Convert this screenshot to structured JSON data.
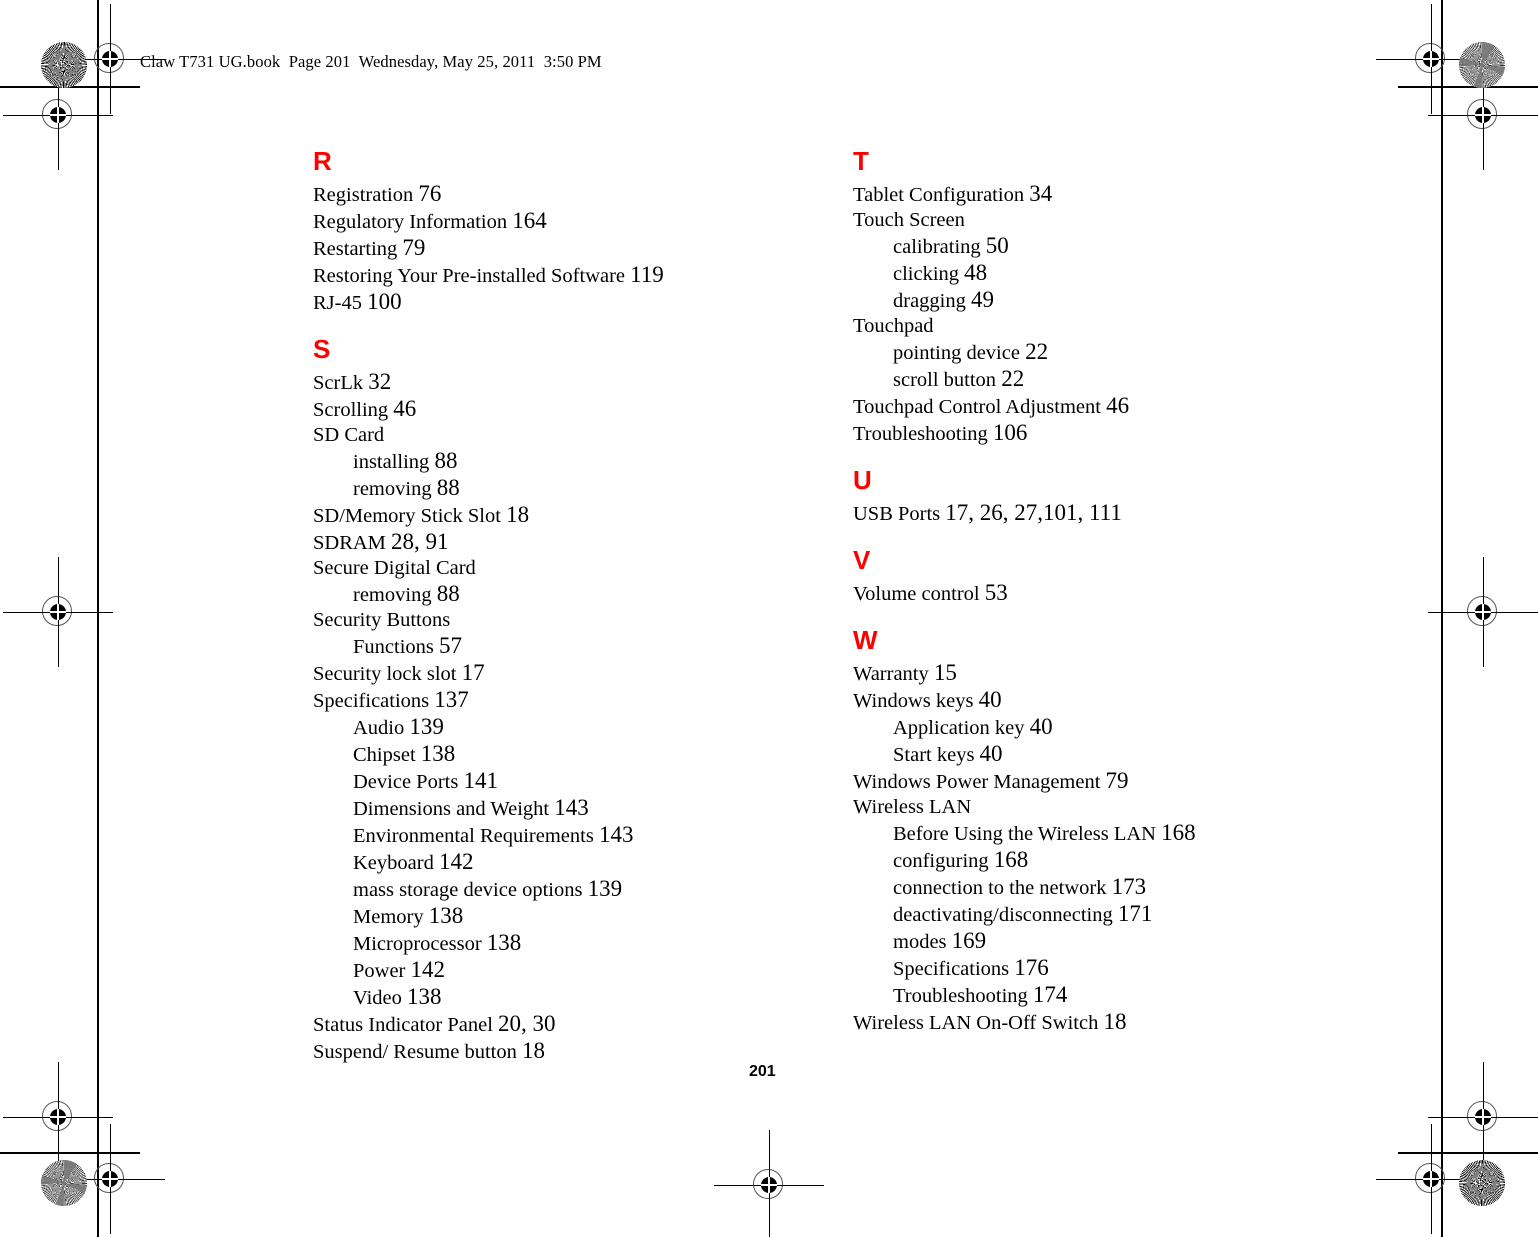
{
  "header": {
    "file_line": "Claw T731 UG.book  Page 201  Wednesday, May 25, 2011  3:50 PM"
  },
  "folio": {
    "page_number": "201"
  },
  "colors": {
    "section_letter": "#ff0000",
    "body_text": "#000000",
    "paper": "#ffffff"
  },
  "marks": {
    "registration_target": "registration-target-icon",
    "color_rosette": "color-registration-rosette-icon"
  },
  "index": {
    "left_column": [
      {
        "letter": "R",
        "entries": [
          {
            "text": "Registration ",
            "pages": "76",
            "level": 0
          },
          {
            "text": "Regulatory Information ",
            "pages": "164",
            "level": 0
          },
          {
            "text": "Restarting ",
            "pages": "79",
            "level": 0
          },
          {
            "text": "Restoring Your Pre-installed Software ",
            "pages": "119",
            "level": 0
          },
          {
            "text": "RJ-45 ",
            "pages": "100",
            "level": 0
          }
        ]
      },
      {
        "letter": "S",
        "entries": [
          {
            "text": "ScrLk ",
            "pages": "32",
            "level": 0
          },
          {
            "text": "Scrolling ",
            "pages": "46",
            "level": 0
          },
          {
            "text": "SD Card",
            "pages": "",
            "level": 0
          },
          {
            "text": "installing ",
            "pages": "88",
            "level": 1
          },
          {
            "text": "removing ",
            "pages": "88",
            "level": 1
          },
          {
            "text": "SD/Memory Stick Slot ",
            "pages": "18",
            "level": 0
          },
          {
            "text": "SDRAM ",
            "pages": "28, 91",
            "level": 0
          },
          {
            "text": "Secure Digital Card",
            "pages": "",
            "level": 0
          },
          {
            "text": "removing ",
            "pages": "88",
            "level": 1
          },
          {
            "text": "Security Buttons",
            "pages": "",
            "level": 0
          },
          {
            "text": "Functions ",
            "pages": "57",
            "level": 1
          },
          {
            "text": "Security lock slot ",
            "pages": "17",
            "level": 0
          },
          {
            "text": "Specifications ",
            "pages": "137",
            "level": 0
          },
          {
            "text": "Audio ",
            "pages": "139",
            "level": 1
          },
          {
            "text": "Chipset ",
            "pages": "138",
            "level": 1
          },
          {
            "text": "Device Ports ",
            "pages": "141",
            "level": 1
          },
          {
            "text": "Dimensions and Weight ",
            "pages": "143",
            "level": 1
          },
          {
            "text": "Environmental Requirements ",
            "pages": "143",
            "level": 1
          },
          {
            "text": "Keyboard ",
            "pages": "142",
            "level": 1
          },
          {
            "text": "mass storage device options ",
            "pages": "139",
            "level": 1
          },
          {
            "text": "Memory ",
            "pages": "138",
            "level": 1
          },
          {
            "text": "Microprocessor ",
            "pages": "138",
            "level": 1
          },
          {
            "text": "Power ",
            "pages": "142",
            "level": 1
          },
          {
            "text": "Video ",
            "pages": "138",
            "level": 1
          },
          {
            "text": "Status Indicator Panel ",
            "pages": "20, 30",
            "level": 0
          },
          {
            "text": "Suspend/ Resume button ",
            "pages": "18",
            "level": 0
          }
        ]
      }
    ],
    "right_column": [
      {
        "letter": "T",
        "entries": [
          {
            "text": "Tablet Configuration ",
            "pages": "34",
            "level": 0
          },
          {
            "text": "Touch Screen",
            "pages": "",
            "level": 0
          },
          {
            "text": "calibrating ",
            "pages": "50",
            "level": 1
          },
          {
            "text": "clicking ",
            "pages": "48",
            "level": 1
          },
          {
            "text": "dragging ",
            "pages": "49",
            "level": 1
          },
          {
            "text": "Touchpad",
            "pages": "",
            "level": 0
          },
          {
            "text": "pointing device ",
            "pages": "22",
            "level": 1
          },
          {
            "text": "scroll button ",
            "pages": "22",
            "level": 1
          },
          {
            "text": "Touchpad Control Adjustment ",
            "pages": "46",
            "level": 0
          },
          {
            "text": "Troubleshooting ",
            "pages": "106",
            "level": 0
          }
        ]
      },
      {
        "letter": "U",
        "entries": [
          {
            "text": "USB Ports ",
            "pages": "17, 26, 27,101, 111",
            "level": 0
          }
        ]
      },
      {
        "letter": "V",
        "entries": [
          {
            "text": "Volume control ",
            "pages": "53",
            "level": 0
          }
        ]
      },
      {
        "letter": "W",
        "entries": [
          {
            "text": "Warranty ",
            "pages": "15",
            "level": 0
          },
          {
            "text": "Windows keys ",
            "pages": "40",
            "level": 0
          },
          {
            "text": "Application key ",
            "pages": "40",
            "level": 1
          },
          {
            "text": "Start keys ",
            "pages": "40",
            "level": 1
          },
          {
            "text": "Windows Power Management ",
            "pages": "79",
            "level": 0
          },
          {
            "text": "Wireless LAN",
            "pages": "",
            "level": 0
          },
          {
            "text": "Before Using the Wireless LAN ",
            "pages": "168",
            "level": 1
          },
          {
            "text": "configuring ",
            "pages": "168",
            "level": 1
          },
          {
            "text": "connection to the network ",
            "pages": "173",
            "level": 1
          },
          {
            "text": "deactivating/disconnecting ",
            "pages": "171",
            "level": 1
          },
          {
            "text": "modes ",
            "pages": "169",
            "level": 1
          },
          {
            "text": "Specifications ",
            "pages": "176",
            "level": 1
          },
          {
            "text": "Troubleshooting ",
            "pages": "174",
            "level": 1
          },
          {
            "text": "Wireless LAN On-Off Switch ",
            "pages": "18",
            "level": 0
          }
        ]
      }
    ]
  }
}
